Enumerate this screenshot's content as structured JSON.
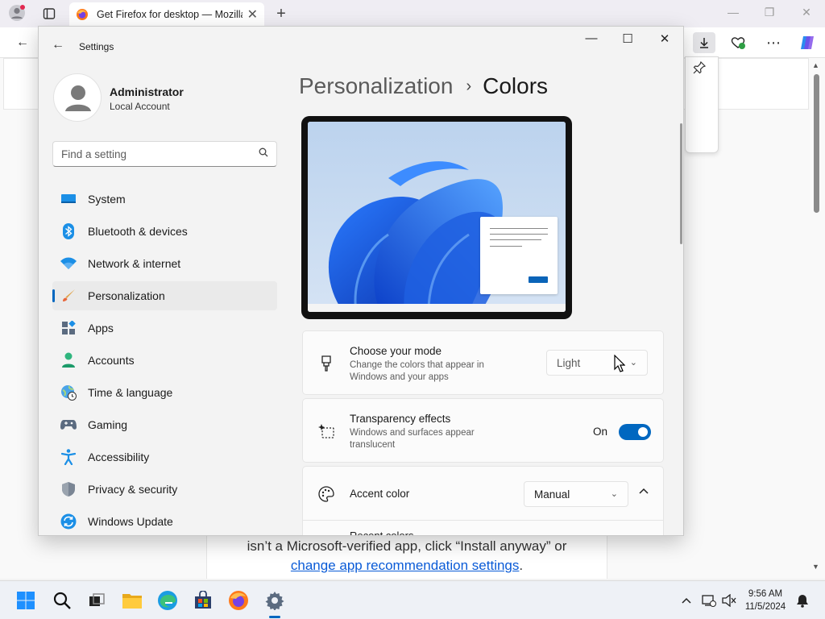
{
  "browser": {
    "tab_title": "Get Firefox for desktop — Mozilla",
    "page_text_line1": "isn’t a Microsoft-verified app, click “Install anyway” or",
    "page_link": "change app recommendation settings",
    "page_text_end": "."
  },
  "settings": {
    "window_title": "Settings",
    "user": {
      "name": "Administrator",
      "account_type": "Local Account"
    },
    "search_placeholder": "Find a setting",
    "nav_items": [
      {
        "label": "System",
        "icon": "monitor-icon"
      },
      {
        "label": "Bluetooth & devices",
        "icon": "bluetooth-icon"
      },
      {
        "label": "Network & internet",
        "icon": "wifi-icon"
      },
      {
        "label": "Personalization",
        "icon": "brush-icon",
        "active": true
      },
      {
        "label": "Apps",
        "icon": "apps-icon"
      },
      {
        "label": "Accounts",
        "icon": "person-icon"
      },
      {
        "label": "Time & language",
        "icon": "globe-clock-icon"
      },
      {
        "label": "Gaming",
        "icon": "gamepad-icon"
      },
      {
        "label": "Accessibility",
        "icon": "accessibility-icon"
      },
      {
        "label": "Privacy & security",
        "icon": "shield-icon"
      },
      {
        "label": "Windows Update",
        "icon": "update-icon"
      }
    ],
    "breadcrumb_parent": "Personalization",
    "breadcrumb_separator": "›",
    "page_title": "Colors",
    "mode": {
      "title": "Choose your mode",
      "subtitle": "Change the colors that appear in Windows and your apps",
      "value": "Light"
    },
    "transparency": {
      "title": "Transparency effects",
      "subtitle": "Windows and surfaces appear translucent",
      "state_label": "On",
      "enabled": true
    },
    "accent": {
      "title": "Accent color",
      "value": "Manual",
      "recent_colors_label": "Recent colors"
    }
  },
  "taskbar": {
    "time": "9:56 AM",
    "date": "11/5/2024"
  },
  "colors": {
    "accent": "#0067c0",
    "link": "#0a5bd7"
  }
}
